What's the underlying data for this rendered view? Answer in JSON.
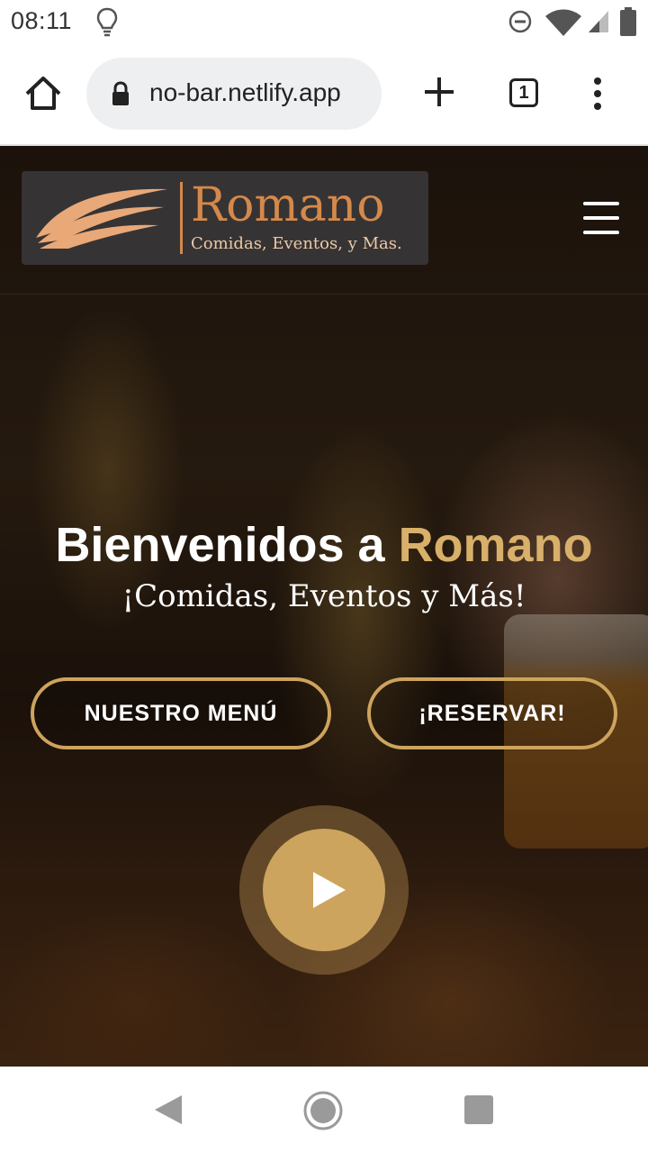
{
  "status_bar": {
    "time": "08:11",
    "icons": [
      "lightbulb-icon",
      "do-not-disturb-icon",
      "wifi-icon",
      "signal-icon",
      "battery-icon"
    ]
  },
  "browser": {
    "url": "no-bar.netlify.app",
    "tab_count": "1",
    "icons": [
      "home-icon",
      "lock-icon",
      "new-tab-plus-icon",
      "tab-switcher-icon",
      "more-vert-icon"
    ]
  },
  "site": {
    "logo": {
      "name": "Romano",
      "tagline": "Comidas, Eventos, y Mas.",
      "color": "#d4894a"
    },
    "hero": {
      "title_prefix": "Bienvenidos a ",
      "title_accent": "Romano",
      "subtitle": "¡Comidas, Eventos y Más!",
      "buttons": {
        "menu": "NUESTRO MENÚ",
        "reserve": "¡RESERVAR!"
      },
      "accent_color": "#cda45e"
    }
  },
  "android_nav": {
    "icons": [
      "back-icon",
      "home-circle-icon",
      "recents-icon"
    ]
  }
}
